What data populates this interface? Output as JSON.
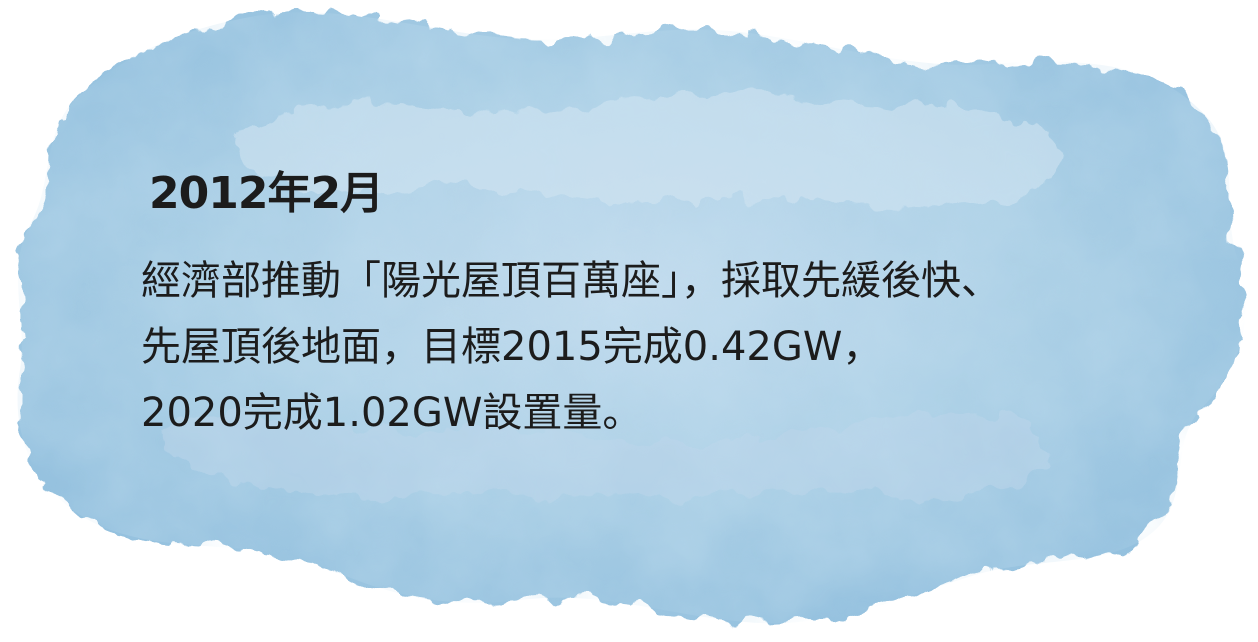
{
  "heading": "2012年2月",
  "lines": [
    "經濟部推動「陽光屋頂百萬座」，採取先緩後快、",
    "先屋頂後地面，目標2015完成0.42GW，",
    "2020完成1.02GW設置量。"
  ],
  "colors": {
    "splash_primary": "#a9cde3",
    "splash_secondary": "#c7dff0",
    "splash_accent": "#8fbddb",
    "text": "#1c1c1c"
  }
}
